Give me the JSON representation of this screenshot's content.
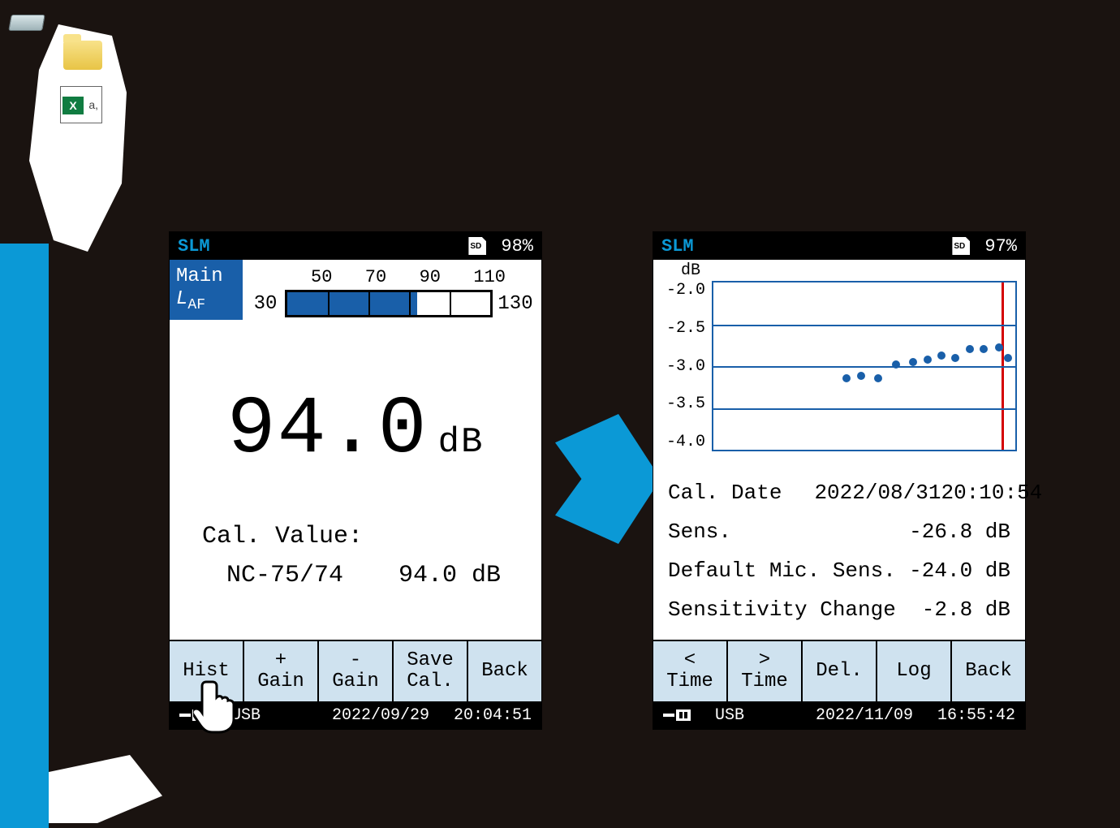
{
  "left_device": {
    "header_title": "SLM",
    "battery": "98%",
    "main_tab_label": "Main",
    "laf_label_prefix": "L",
    "laf_label_sub": "AF",
    "bar": {
      "min": "30",
      "max": "130",
      "ticks": [
        "50",
        "70",
        "90",
        "110"
      ],
      "value_percent": 64
    },
    "reading_value": "94.0",
    "reading_unit": "dB",
    "cal_label": "Cal. Value:",
    "cal_model": "NC-75/74",
    "cal_value": "94.0 dB",
    "softkeys": [
      "Hist",
      "+\nGain",
      "-\nGain",
      "Save\nCal.",
      "Back"
    ],
    "footer_conn": "USB",
    "footer_date": "2022/09/29",
    "footer_time": "20:04:51"
  },
  "right_device": {
    "header_title": "SLM",
    "battery": "97%",
    "y_unit": "dB",
    "info": {
      "cal_date_label": "Cal. Date",
      "cal_date": "2022/08/31",
      "cal_time": "20:10:54",
      "sens_label": "Sens.",
      "sens_value": "-26.8 dB",
      "default_label": "Default Mic. Sens.",
      "default_value": "-24.0 dB",
      "change_label": "Sensitivity Change",
      "change_value": "-2.8 dB"
    },
    "softkeys": [
      "<\nTime",
      ">\nTime",
      "Del.",
      "Log",
      "Back"
    ],
    "footer_conn": "USB",
    "footer_date": "2022/11/09",
    "footer_time": "16:55:42"
  },
  "chart_data": {
    "type": "scatter",
    "ylabel": "dB",
    "ylim": [
      -4.0,
      -2.0
    ],
    "yticks": [
      -2.0,
      -2.5,
      -3.0,
      -3.5,
      -4.0
    ],
    "yticklabels": [
      "-2.0",
      "-2.5",
      "-3.0",
      "-3.5",
      "-4.0"
    ],
    "points": [
      {
        "x": 0.44,
        "y": -3.15
      },
      {
        "x": 0.49,
        "y": -3.12
      },
      {
        "x": 0.545,
        "y": -3.15
      },
      {
        "x": 0.605,
        "y": -2.98
      },
      {
        "x": 0.66,
        "y": -2.95
      },
      {
        "x": 0.71,
        "y": -2.92
      },
      {
        "x": 0.755,
        "y": -2.87
      },
      {
        "x": 0.8,
        "y": -2.9
      },
      {
        "x": 0.85,
        "y": -2.8
      },
      {
        "x": 0.895,
        "y": -2.8
      },
      {
        "x": 0.945,
        "y": -2.78
      },
      {
        "x": 0.975,
        "y": -2.9
      }
    ]
  }
}
